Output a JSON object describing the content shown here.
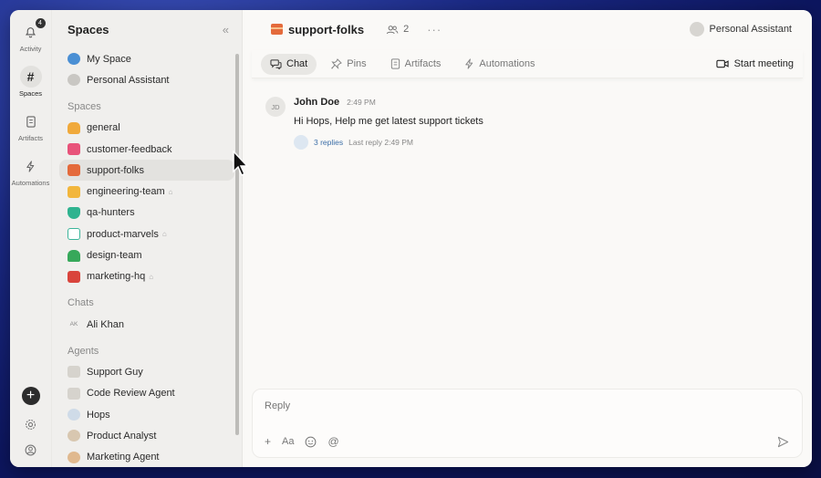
{
  "rail": {
    "items": [
      {
        "label": "Activity",
        "badge": "4"
      },
      {
        "label": "Spaces"
      },
      {
        "label": "Artifacts"
      },
      {
        "label": "Automations"
      }
    ]
  },
  "sidebar": {
    "title": "Spaces",
    "top_items": [
      {
        "label": "My Space"
      },
      {
        "label": "Personal Assistant"
      }
    ],
    "spaces_label": "Spaces",
    "spaces": [
      {
        "label": "general"
      },
      {
        "label": "customer-feedback"
      },
      {
        "label": "support-folks"
      },
      {
        "label": "engineering-team"
      },
      {
        "label": "qa-hunters"
      },
      {
        "label": "product-marvels"
      },
      {
        "label": "design-team"
      },
      {
        "label": "marketing-hq"
      }
    ],
    "chats_label": "Chats",
    "chats": [
      {
        "label": "Ali Khan",
        "initials": "AK"
      }
    ],
    "agents_label": "Agents",
    "agents": [
      {
        "label": "Support Guy"
      },
      {
        "label": "Code Review Agent"
      },
      {
        "label": "Hops"
      },
      {
        "label": "Product Analyst"
      },
      {
        "label": "Marketing Agent"
      }
    ]
  },
  "header": {
    "channel": "support-folks",
    "member_count": "2",
    "assistant": "Personal Assistant"
  },
  "tabs": [
    {
      "label": "Chat"
    },
    {
      "label": "Pins"
    },
    {
      "label": "Artifacts"
    },
    {
      "label": "Automations"
    }
  ],
  "start_meeting": "Start meeting",
  "message": {
    "initials": "JD",
    "author": "John Doe",
    "time": "2:49 PM",
    "text": "Hi Hops, Help me get latest support tickets",
    "replies": "3 replies",
    "last_reply": "Last reply 2:49 PM"
  },
  "composer": {
    "placeholder": "Reply"
  },
  "colors": {
    "accent_link": "#3d6fa8",
    "background_gradient": "#1b2a86"
  }
}
